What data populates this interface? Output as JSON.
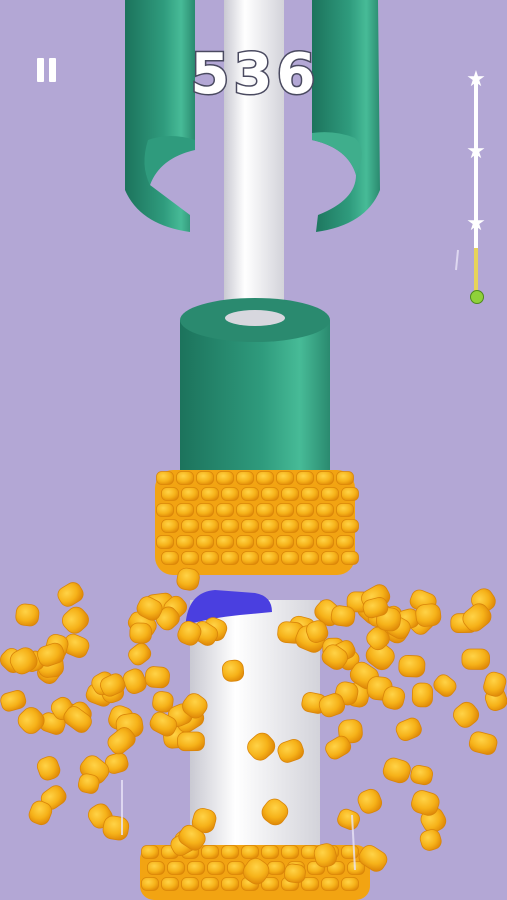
{
  "hud": {
    "score": "536",
    "pause_icon": "pause-icon",
    "progress": 0.22,
    "progress_stars": [
      "star-icon",
      "star-icon",
      "star-icon"
    ]
  },
  "colors": {
    "background": "#b3a7d5",
    "pole": "#ececf0",
    "ring_green": "#2f9a7c",
    "ring_green_dark": "#1f7a61",
    "corn_yellow": "#f7b51a",
    "corn_dark": "#e38f0a",
    "ball_blue": "#4a3fe0"
  }
}
